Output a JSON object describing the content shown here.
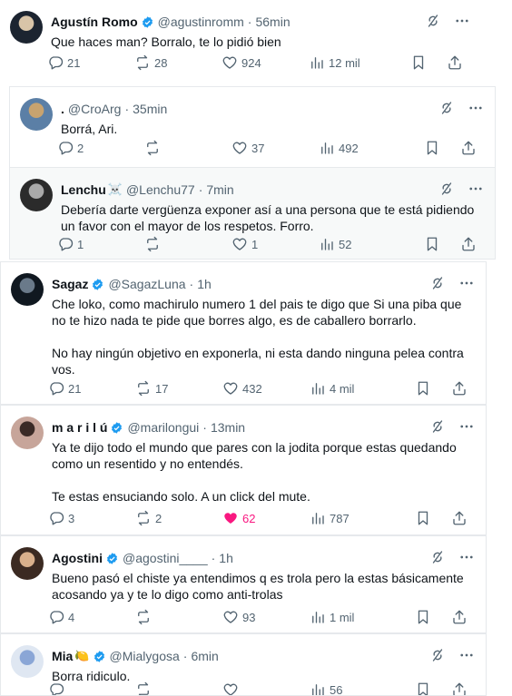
{
  "posts": [
    {
      "name": "Agustín Romo",
      "verified": true,
      "name_emoji": "",
      "handle": "@agustinromm",
      "time": "56min",
      "text": "Que haces man? Borralo, te lo pidió bien",
      "replies": "21",
      "reposts": "28",
      "likes": "924",
      "views": "12 mil",
      "liked": false
    },
    {
      "name": ".",
      "verified": false,
      "name_emoji": "",
      "handle": "@CroArg",
      "time": "35min",
      "text": "Borrá, Ari.",
      "replies": "2",
      "reposts": "",
      "likes": "37",
      "views": "492",
      "liked": false
    },
    {
      "name": "Lenchu",
      "verified": false,
      "name_emoji": "☠️",
      "handle": "@Lenchu77",
      "time": "7min",
      "text": "Debería darte vergüenza exponer así a una persona que te está pidiendo un favor con el mayor de los respetos. Forro.",
      "replies": "1",
      "reposts": "",
      "likes": "1",
      "views": "52",
      "liked": false
    },
    {
      "name": "Sagaz",
      "verified": true,
      "name_emoji": "",
      "handle": "@SagazLuna",
      "time": "1h",
      "text": "Che loko, como machirulo numero 1 del pais te digo que Si una piba que no te hizo nada te pide que borres algo, es de caballero borrarlo.\n\nNo hay ningún objetivo en exponerla, ni esta dando ninguna pelea contra vos.",
      "replies": "21",
      "reposts": "17",
      "likes": "432",
      "views": "4 mil",
      "liked": false
    },
    {
      "name": "m a r i l ú",
      "verified": true,
      "name_emoji": "",
      "handle": "@marilongui",
      "time": "13min",
      "text": "Ya te dijo todo el mundo que pares con la jodita porque estas quedando como un resentido y no entendés.\n\nTe estas ensuciando solo. A un click del mute.",
      "replies": "3",
      "reposts": "2",
      "likes": "62",
      "views": "787",
      "liked": true
    },
    {
      "name": "Agostini",
      "verified": true,
      "name_emoji": "",
      "handle": "@agostini____",
      "time": "1h",
      "text": "Bueno pasó el chiste ya entendimos q es trola pero la estas básicamente acosando ya y te lo digo como anti-trolas",
      "replies": "4",
      "reposts": "",
      "likes": "93",
      "views": "1 mil",
      "liked": false
    },
    {
      "name": "Mia",
      "verified": true,
      "name_emoji": "🍋",
      "handle": "@Mialygosa",
      "time": "6min",
      "text": "Borra ridiculo.",
      "replies": "",
      "reposts": "",
      "likes": "",
      "views": "56",
      "liked": false
    }
  ],
  "colors": {
    "text": "#0f1419",
    "muted": "#536471",
    "verified": "#1d9bf0",
    "like": "#f91880",
    "border": "#e6e9ec"
  },
  "icons": [
    "verified-badge-icon",
    "grok-icon",
    "more-icon",
    "reply-icon",
    "repost-icon",
    "like-icon",
    "views-icon",
    "bookmark-icon",
    "share-icon"
  ]
}
